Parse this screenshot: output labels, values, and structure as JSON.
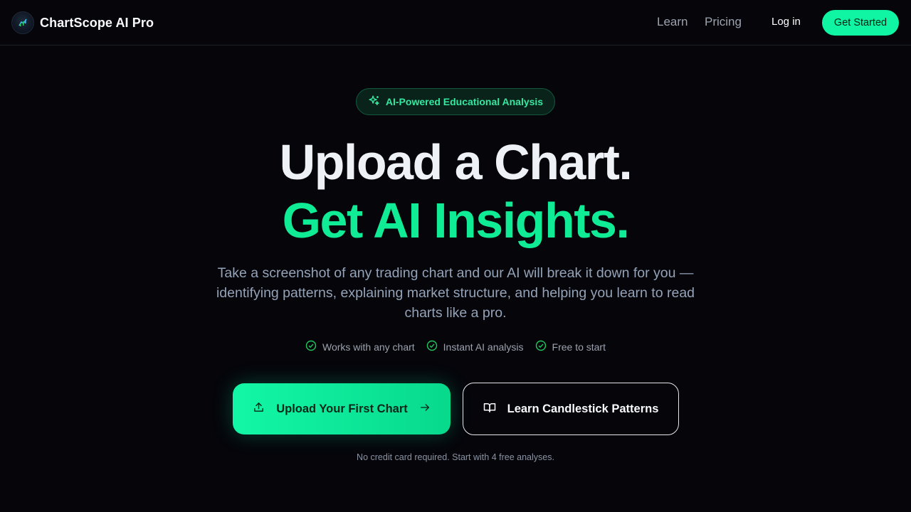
{
  "brand": {
    "name": "ChartScope AI Pro",
    "logo_icon": "chart-logo-icon"
  },
  "nav": {
    "links": [
      "Learn",
      "Pricing"
    ],
    "login_label": "Log in",
    "cta_label": "Get Started"
  },
  "hero": {
    "badge": {
      "icon": "sparkles-icon",
      "label": "AI-Powered Educational Analysis"
    },
    "headline_line1": "Upload a Chart.",
    "headline_line2": "Get AI Insights.",
    "description": "Take a screenshot of any trading chart and our AI will break it down for you — identifying patterns, explaining market structure, and helping you learn to read charts like a pro.",
    "features": [
      "Works with any chart",
      "Instant AI analysis",
      "Free to start"
    ],
    "primary_cta": {
      "label": "Upload Your First Chart",
      "icon": "upload-icon",
      "trailing_icon": "arrow-right-icon"
    },
    "secondary_cta": {
      "label": "Learn Candlestick Patterns",
      "icon": "book-open-icon"
    },
    "footnote": "No credit card required. Start with 4 free analyses."
  },
  "colors": {
    "background": "#05050a",
    "accent": "#10f5a3",
    "accent_text": "#10ec95",
    "muted_text": "#94a3b8"
  }
}
